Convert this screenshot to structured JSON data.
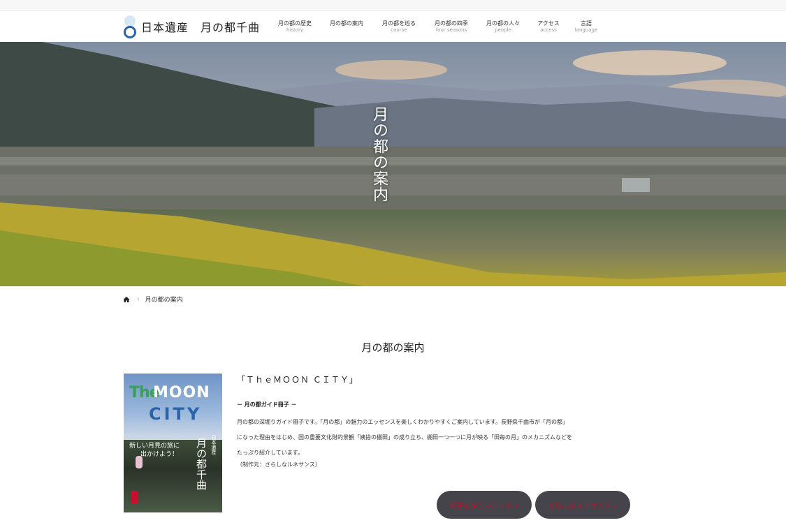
{
  "site": {
    "logo_text": "日本遺産　月の都千曲"
  },
  "nav": [
    {
      "jp": "月の都の歴史",
      "en": "history"
    },
    {
      "jp": "月の都の案内",
      "en": ""
    },
    {
      "jp": "月の都を巡る",
      "en": "course"
    },
    {
      "jp": "月の都の四季",
      "en": "four seasons"
    },
    {
      "jp": "月の都の人々",
      "en": "people"
    },
    {
      "jp": "アクセス",
      "en": "access"
    },
    {
      "jp": "言語",
      "en": "language"
    }
  ],
  "hero": {
    "title": "月の都の案内"
  },
  "breadcrumb": {
    "current": "月の都の案内",
    "separator": "›"
  },
  "page": {
    "title": "月の都の案内"
  },
  "cover": {
    "the": "The",
    "moon": "MOON",
    "city": "CITY",
    "tagline_1": "新しい月見の旅に",
    "tagline_2": "出かけよう！",
    "vertical_name": "月の都千曲",
    "vertical_sub": "日本遺産"
  },
  "article": {
    "subtitle": "「ＴｈｅＭＯＯＮ ＣＩＴＹ」",
    "guide_title": "－ 月の都ガイド冊子 －",
    "line_1": "月の都の深堀りガイド冊子です。「月の都」の魅力のエッセンスを楽しくわかりやすくご案内しています。長野県千曲市が「月の都」",
    "line_2": "になった理由をはじめ、国の重要文化財的景観「姨捨の棚田」の成り立ち、棚田一つ一つに月が映る「田毎の月」のメカニズムなどを",
    "line_3": "たっぷり紹介しています。",
    "publisher": "（制作元：さらしなルネサンス）"
  },
  "buttons": {
    "download": "冊子をダウンロード »",
    "sarashina": "さらしなルネサンス »"
  },
  "colors": {
    "accent_blue": "#2b63a8",
    "button_bg": "#44444a",
    "button_text": "#c8102e"
  }
}
